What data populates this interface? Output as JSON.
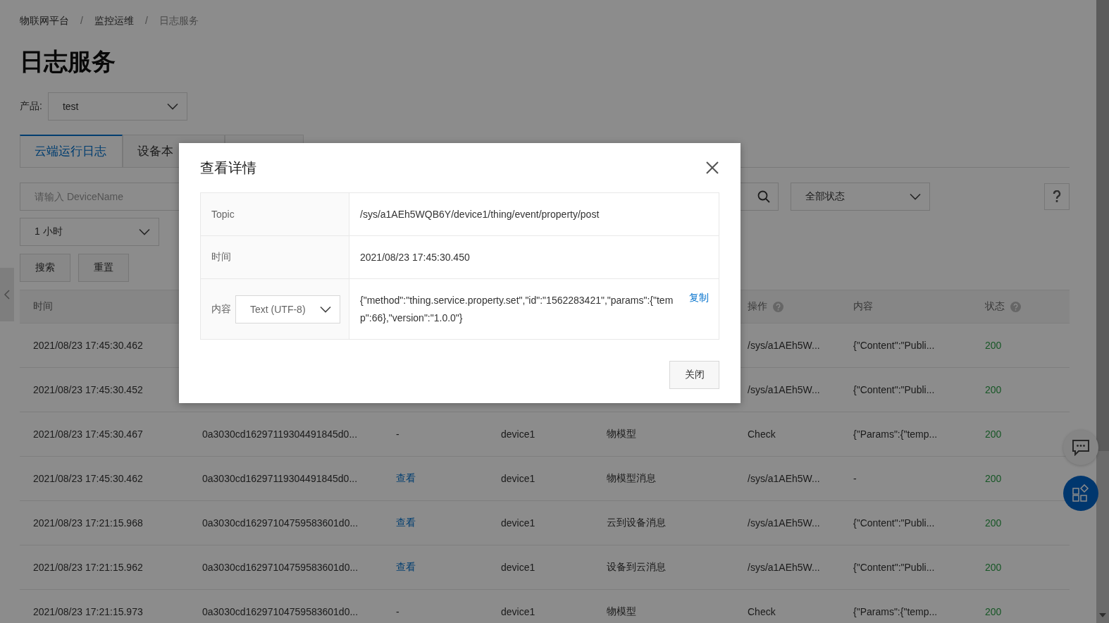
{
  "breadcrumb": [
    {
      "text": "物联网平台",
      "kind": "link"
    },
    {
      "text": "/",
      "kind": "separator"
    },
    {
      "text": "监控运维",
      "kind": "link"
    },
    {
      "text": "/",
      "kind": "separator"
    },
    {
      "text": "日志服务",
      "kind": "current"
    }
  ],
  "page_title": "日志服务",
  "product_filter": {
    "label": "产品:",
    "value": "test"
  },
  "tabs": [
    {
      "label": "云端运行日志",
      "selected": true
    },
    {
      "label": "设备本",
      "selected": false
    },
    {
      "selected": false
    }
  ],
  "filters": {
    "device_search": {
      "placeholder": "请输入 DeviceName"
    },
    "status_select": {
      "value": "全部状态"
    },
    "time_range": {
      "value": "1 小时"
    }
  },
  "buttons": [
    "搜索",
    "重置"
  ],
  "table": {
    "columns": [
      {
        "label": "时间"
      },
      {},
      {},
      {},
      {},
      {
        "label": "操作",
        "help": true
      },
      {
        "label": "内容"
      },
      {
        "label": "状态",
        "help": true
      }
    ],
    "rows": [
      {
        "time": "2021/08/23 17:45:30.462",
        "op": "/sys/a1AEh5W...",
        "content": "{\"Content\":\"Publi...",
        "status": "200"
      },
      {
        "time": "2021/08/23 17:45:30.452",
        "op": "/sys/a1AEh5W...",
        "content": "{\"Content\":\"Publi...",
        "status": "200"
      },
      {
        "time": "2021/08/23 17:45:30.467",
        "id": "0a3030cd16297119304491845d0...",
        "detail": {
          "text": "-",
          "kind": "text"
        },
        "device": "device1",
        "type": "物模型",
        "op": "Check",
        "content": "{\"Params\":{\"temp...",
        "status": "200"
      },
      {
        "time": "2021/08/23 17:45:30.462",
        "id": "0a3030cd16297119304491845d0...",
        "detail": {
          "text": "查看",
          "kind": "link"
        },
        "device": "device1",
        "type": "物模型消息",
        "op": "/sys/a1AEh5W...",
        "content": "-",
        "status": "200"
      },
      {
        "time": "2021/08/23 17:21:15.968",
        "id": "0a3030cd16297104759583601d0...",
        "detail": {
          "text": "查看",
          "kind": "link"
        },
        "device": "device1",
        "type": "云到设备消息",
        "op": "/sys/a1AEh5W...",
        "content": "{\"Content\":\"Publi...",
        "status": "200"
      },
      {
        "time": "2021/08/23 17:21:15.962",
        "id": "0a3030cd16297104759583601d0...",
        "detail": {
          "text": "查看",
          "kind": "link"
        },
        "device": "device1",
        "type": "设备到云消息",
        "op": "/sys/a1AEh5W...",
        "content": "{\"Content\":\"Publi...",
        "status": "200"
      },
      {
        "time": "2021/08/23 17:21:15.973",
        "id": "0a3030cd16297104759583601d0...",
        "detail": {
          "text": "-",
          "kind": "text"
        },
        "device": "device1",
        "type": "物模型",
        "op": "Check",
        "content": "{\"Params\":{\"temp...",
        "status": "200"
      }
    ]
  },
  "dialog": {
    "title": "查看详情",
    "fields": [
      {
        "label": "Topic",
        "value": "/sys/a1AEh5WQB6Y/device1/thing/event/property/post"
      },
      {
        "label": "时间",
        "value": "2021/08/23 17:45:30.450"
      },
      {
        "label": "内容",
        "format": "Text (UTF-8)",
        "value": "{\"method\":\"thing.service.property.set\",\"id\":\"1562283421\",\"params\":{\"temp\":66},\"version\":\"1.0.0\"}",
        "action": "复制"
      }
    ],
    "buttons": [
      "关闭"
    ]
  }
}
